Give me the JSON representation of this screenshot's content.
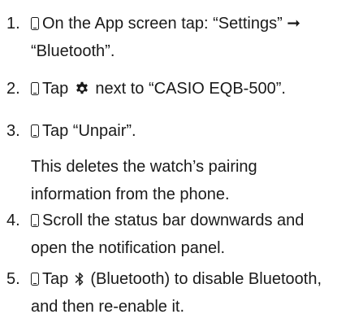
{
  "steps": [
    {
      "number": "1.",
      "line1_text": "On the App screen tap: “Settings” ➞",
      "line2_text": "“Bluetooth”."
    },
    {
      "number": "2.",
      "text_before_icon": "Tap",
      "text_after_icon": "next to “CASIO EQB-500”."
    },
    {
      "number": "3.",
      "line1_text": "Tap “Unpair”.",
      "note_line1": "This deletes the watch’s pairing",
      "note_line2": "information from the phone."
    },
    {
      "number": "4.",
      "line1_text": "Scroll the status bar downwards and",
      "line2_text": "open the notification panel."
    },
    {
      "number": "5.",
      "text_before_icon": "Tap",
      "text_after_icon": "(Bluetooth) to disable Bluetooth,",
      "line2_text": "and then re-enable it."
    }
  ],
  "icons": {
    "step_prefix": "phone-icon",
    "settings": "gear-icon",
    "bluetooth": "bluetooth-icon"
  }
}
